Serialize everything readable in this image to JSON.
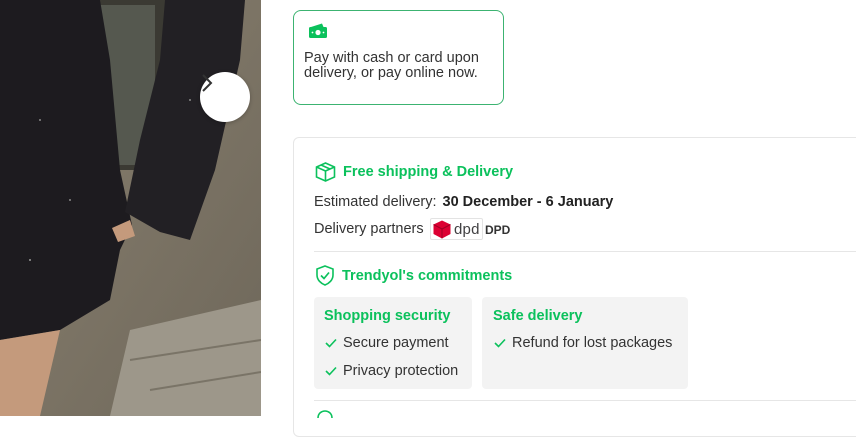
{
  "payment": {
    "icon": "cash-icon",
    "text": "Pay with cash or card upon delivery, or pay online now."
  },
  "shipping": {
    "icon": "package-icon",
    "title": "Free shipping & Delivery",
    "estimated_label": "Estimated delivery:",
    "estimated_value": "30 December - 6 January",
    "partners_label": "Delivery partners",
    "partner_logo_word": "dpd",
    "partner_name": "DPD"
  },
  "commitments": {
    "icon": "shield-check-icon",
    "title": "Trendyol's commitments",
    "boxes": [
      {
        "title": "Shopping security",
        "items": [
          "Secure payment",
          "Privacy protection"
        ]
      },
      {
        "title": "Safe delivery",
        "items": [
          "Refund for lost packages"
        ]
      }
    ]
  },
  "colors": {
    "accent": "#0bc15c",
    "card_border": "#3cb371",
    "dpd_red": "#dc0032"
  }
}
